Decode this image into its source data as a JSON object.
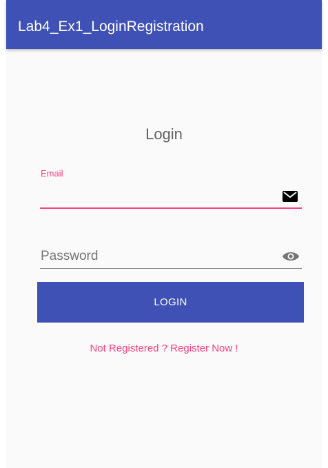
{
  "app_bar": {
    "title": "Lab4_Ex1_LoginRegistration",
    "color": "#3f51b5"
  },
  "form": {
    "heading": "Login",
    "email": {
      "label": "Email",
      "value": "",
      "icon": "mail-icon"
    },
    "password": {
      "placeholder": "Password",
      "value": "",
      "icon": "eye-icon"
    },
    "login_button_label": "LOGIN",
    "register_link": "Not Registered ? Register Now !"
  },
  "colors": {
    "primary": "#3f51b5",
    "accent": "#ff4081",
    "background": "#fafafa"
  }
}
